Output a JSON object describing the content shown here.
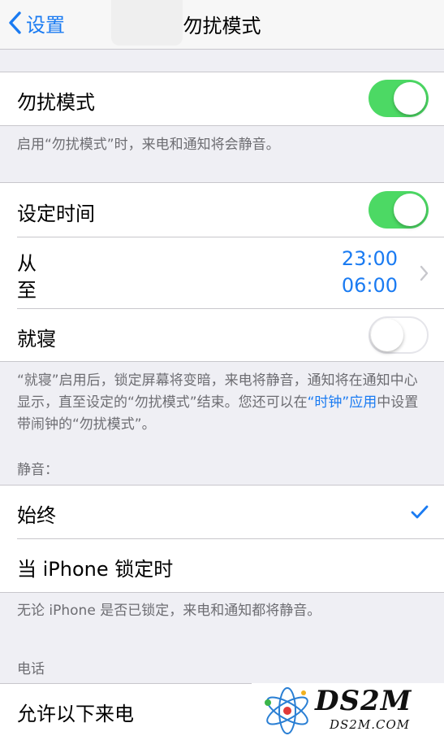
{
  "nav": {
    "back_label": "设置",
    "title": "勿扰模式"
  },
  "dnd": {
    "label": "勿扰模式",
    "toggle_on": true,
    "footer": "启用“勿扰模式”时，来电和通知将会静音。"
  },
  "schedule": {
    "label": "设定时间",
    "toggle_on": true,
    "from_label": "从",
    "to_label": "至",
    "from_time": "23:00",
    "to_time": "06:00"
  },
  "bedtime": {
    "label": "就寝",
    "toggle_on": false,
    "footer_part1": "“就寝”启用后，锁定屏幕将变暗，来电将静音，通知将在通知中心显示，直至设定的“勿扰模式”结束。您还可以在",
    "footer_link": "“时钟”应用",
    "footer_part2": "中设置带闹钟的“勿扰模式”。"
  },
  "silence": {
    "header": "静音：",
    "option_always": "始终",
    "option_locked": "当 iPhone 锁定时",
    "selected": "始终",
    "footer": "无论 iPhone 是否已锁定，来电和通知都将静音。"
  },
  "phone": {
    "header": "电话",
    "allow_calls_label": "允许以下来电"
  },
  "watermark": {
    "main": "DS2M",
    "sub": "DS2M.COM"
  },
  "colors": {
    "accent": "#1a7bf2",
    "toggle_on": "#4cd964",
    "background": "#efeff4"
  }
}
